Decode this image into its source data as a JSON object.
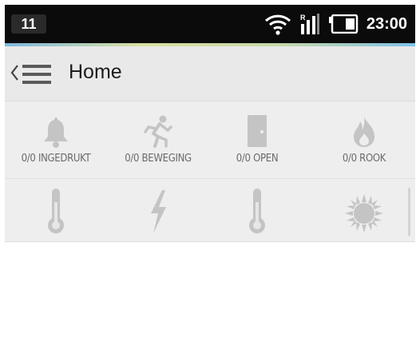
{
  "status_bar": {
    "notification_count": "11",
    "time": "23:00",
    "icons": [
      "wifi-icon",
      "signal-icon",
      "battery-icon"
    ]
  },
  "action_bar": {
    "title": "Home",
    "icons": [
      "up-caret-icon",
      "hamburger-menu-icon"
    ]
  },
  "tiles": [
    {
      "label": "0/0 INGEDRUKT",
      "icon": "bell-icon"
    },
    {
      "label": "0/0 BEWEGING",
      "icon": "running-person-icon"
    },
    {
      "label": "0/0 OPEN",
      "icon": "door-icon"
    },
    {
      "label": "0/0 ROOK",
      "icon": "flame-icon"
    },
    {
      "label": "",
      "icon": "thermometer-icon"
    },
    {
      "label": "",
      "icon": "lightning-icon"
    },
    {
      "label": "",
      "icon": "thermometer-icon"
    },
    {
      "label": "",
      "icon": "sun-icon"
    }
  ],
  "colors": {
    "status_bar_bg": "#0b0b0b",
    "action_bar_bg": "#e9e9e9",
    "tile_icon": "#c4c4c4",
    "tile_label": "#6a6a6a"
  }
}
